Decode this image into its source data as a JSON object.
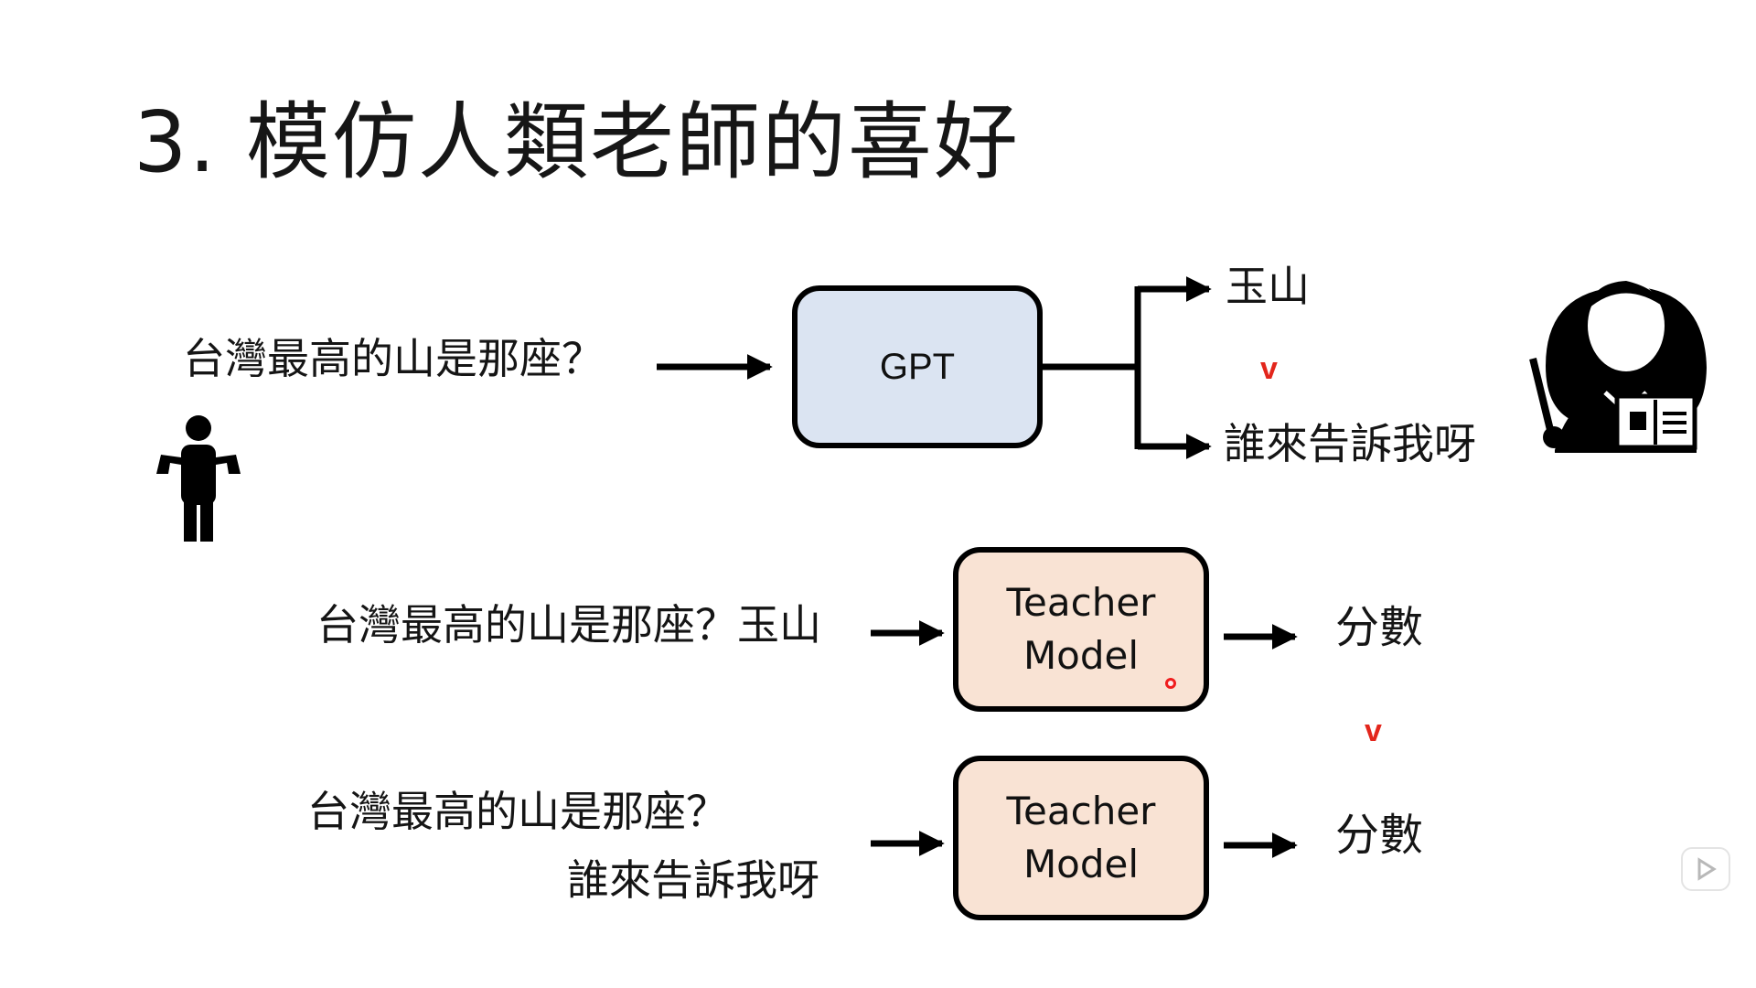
{
  "title": "3. 模仿人類老師的喜好",
  "row1": {
    "question": "台灣最高的山是那座？",
    "model_label": "GPT",
    "answer_good": "玉山",
    "comparator": "v",
    "answer_bad": "誰來告訴我呀"
  },
  "row2": {
    "input": "台灣最高的山是那座？玉山",
    "model_line1": "Teacher",
    "model_line2": "Model",
    "output": "分數"
  },
  "comparator2": "v",
  "row3": {
    "input_line1": "台灣最高的山是那座？",
    "input_line2": "誰來告訴我呀",
    "model_line1": "Teacher",
    "model_line2": "Model",
    "output": "分數"
  },
  "icons": {
    "user": "person-shrugging-icon",
    "teacher": "teacher-with-book-icon",
    "video": "play-button-icon"
  },
  "colors": {
    "gpt_box": "#dbe4f2",
    "teacher_box": "#f9e3d4",
    "comparator": "#e3261c"
  }
}
